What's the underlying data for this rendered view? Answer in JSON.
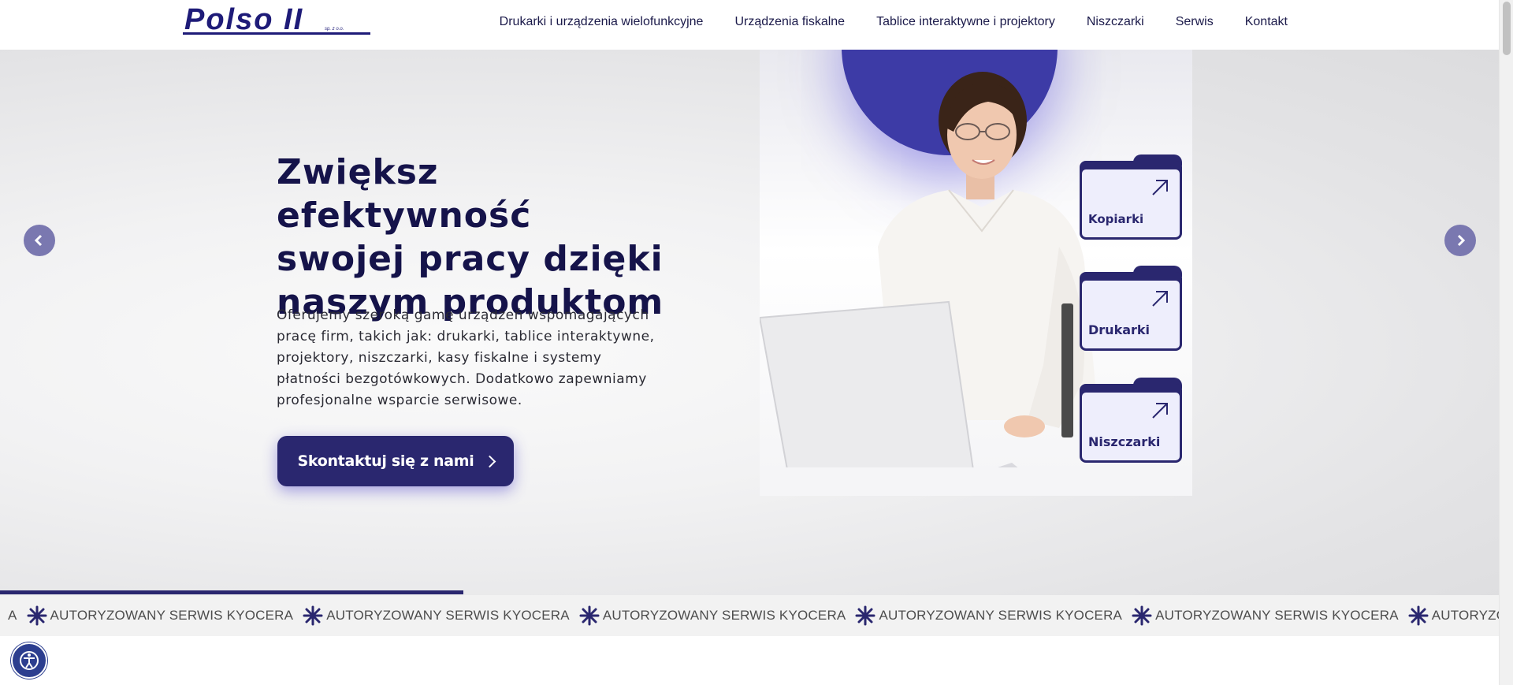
{
  "header": {
    "logo": {
      "text": "Polso II",
      "sub": "sp. z o.o."
    },
    "nav": [
      "Drukarki i urządzenia wielofunkcyjne",
      "Urządzenia fiskalne",
      "Tablice interaktywne i projektory",
      "Niszczarki",
      "Serwis",
      "Kontakt"
    ]
  },
  "hero": {
    "title_lines": [
      "Zwiększ efektywność",
      "swojej pracy dzięki",
      "naszym produktom"
    ],
    "description": "Oferujemy szeroką gamę urządzeń wspomagających pracę firm, takich jak: drukarki, tablice interaktywne, projektory, niszczarki, kasy fiskalne i systemy płatności bezgotówkowych. Dodatkowo zapewniamy profesjonalne wsparcie serwisowe.",
    "cta": "Skontaktuj się z nami",
    "categories": [
      "Kopiarki",
      "Drukarki",
      "Niszczarki"
    ]
  },
  "slider": {
    "progress": 0.25
  },
  "marquee": {
    "lead": "A",
    "item": "AUTORYZOWANY SERWIS KYOCERA",
    "repeat": 6
  },
  "colors": {
    "brand": "#2a276f",
    "accent": "#3d3ba6",
    "text": "#15134a"
  },
  "icons": [
    "chevron-left-icon",
    "chevron-right-icon",
    "arrow-up-right-icon",
    "asterisk-icon",
    "accessibility-icon"
  ]
}
